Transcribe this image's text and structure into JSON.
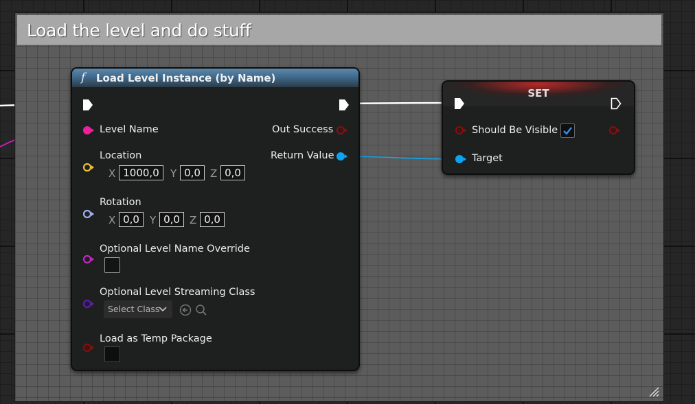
{
  "comment": {
    "title": "Load the level and do stuff"
  },
  "load_node": {
    "title": "Load Level Instance (by Name)",
    "function_icon": "f",
    "inputs": {
      "level_name": "Level Name",
      "location": "Location",
      "location_x": "1000,0",
      "location_y": "0,0",
      "location_z": "0,0",
      "rotation": "Rotation",
      "rotation_x": "0,0",
      "rotation_y": "0,0",
      "rotation_z": "0,0",
      "optional_level_name_override": "Optional Level Name Override",
      "optional_level_streaming_class": "Optional Level Streaming Class",
      "select_class": "Select Class",
      "load_as_temp_package": "Load as Temp Package"
    },
    "outputs": {
      "out_success": "Out Success",
      "return_value": "Return Value"
    },
    "axis_labels": {
      "x": "X",
      "y": "Y",
      "z": "Z"
    }
  },
  "set_node": {
    "title": "SET",
    "inputs": {
      "should_be_visible": "Should Be Visible",
      "should_be_visible_checked": true,
      "target": "Target"
    }
  },
  "colors": {
    "exec_pin": "#ffffff",
    "string_pin": "#f01fa0",
    "vector_pin": "#f0c02f",
    "rotator_pin": "#9fb2f0",
    "name_pin": "#c823c8",
    "class_pin": "#5b1fa8",
    "bool_pin": "#8a0e0e",
    "object_pin": "#0ba3f3",
    "check_mark": "#3a8cf0"
  }
}
